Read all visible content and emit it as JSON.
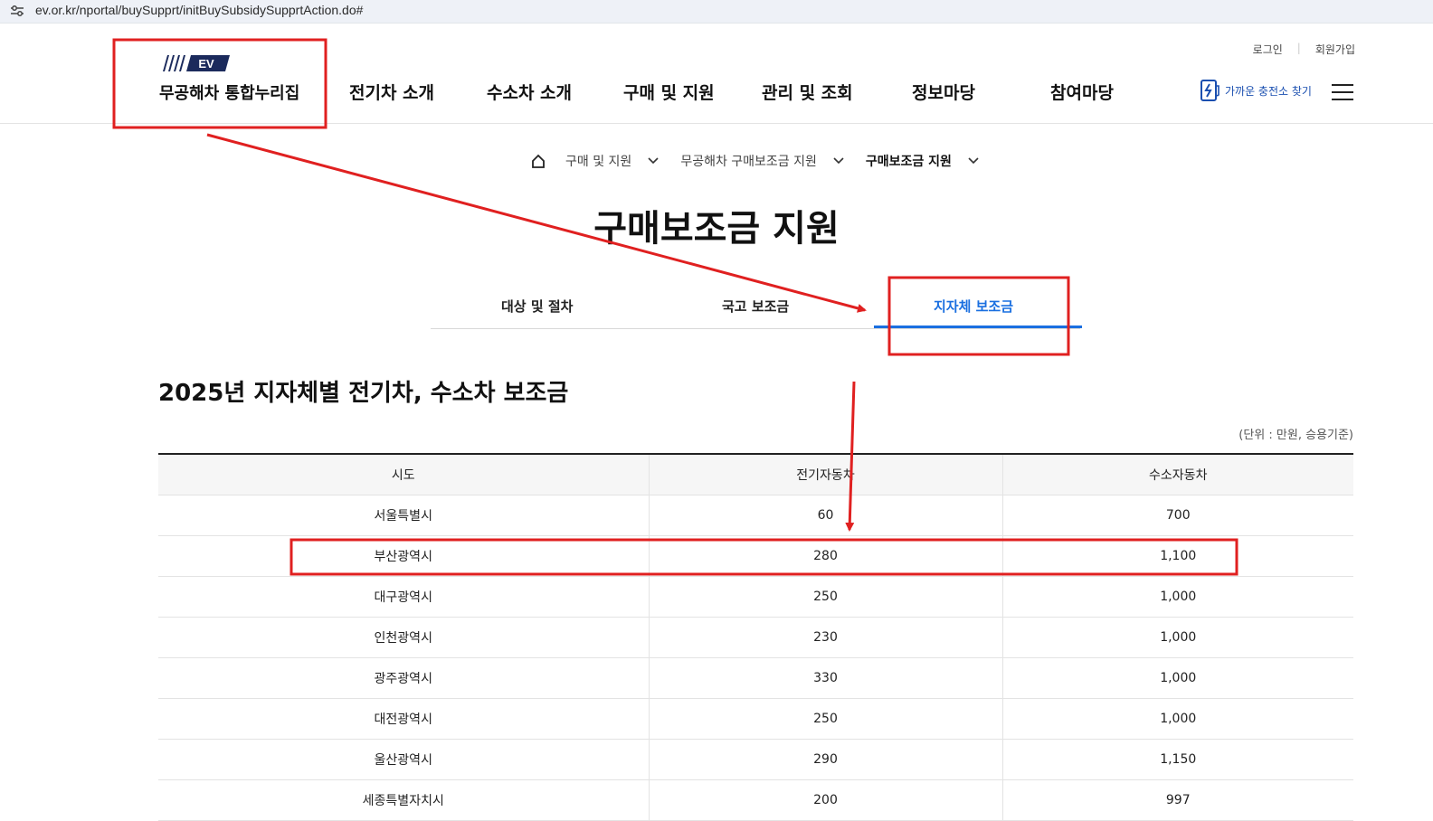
{
  "browser": {
    "url": "ev.or.kr/nportal/buySupprt/initBuySubsidySupprtAction.do#"
  },
  "header": {
    "util_links": [
      "로그인",
      "회원가입"
    ],
    "logo_mark": "EV",
    "logo_name": "무공해차 통합누리집",
    "nav": [
      "전기차 소개",
      "수소차 소개",
      "구매 및 지원",
      "관리 및 조회",
      "정보마당",
      "참여마당"
    ],
    "charge_link": "가까운 충전소 찾기",
    "menu_icon": "hamburger-icon"
  },
  "breadcrumb": [
    "구매 및 지원",
    "무공해차 구매보조금 지원",
    "구매보조금 지원"
  ],
  "page_title": "구매보조금 지원",
  "tabs": [
    {
      "label": "대상 및 절차",
      "active": false
    },
    {
      "label": "국고 보조금",
      "active": false
    },
    {
      "label": "지자체 보조금",
      "active": true
    }
  ],
  "section_title": "2025년 지자체별 전기차, 수소차 보조금",
  "unit_note": "(단위 : 만원, 승용기준)",
  "table": {
    "headers": [
      "시도",
      "전기자동차",
      "수소자동차"
    ],
    "rows": [
      [
        "서울특별시",
        "60",
        "700"
      ],
      [
        "부산광역시",
        "280",
        "1,100"
      ],
      [
        "대구광역시",
        "250",
        "1,000"
      ],
      [
        "인천광역시",
        "230",
        "1,000"
      ],
      [
        "광주광역시",
        "330",
        "1,000"
      ],
      [
        "대전광역시",
        "250",
        "1,000"
      ],
      [
        "울산광역시",
        "290",
        "1,150"
      ],
      [
        "세종특별자치시",
        "200",
        "997"
      ]
    ]
  },
  "colors": {
    "accent": "#1a6fe0",
    "annotation": "#e02020",
    "brand_navy": "#1b2a5c"
  }
}
